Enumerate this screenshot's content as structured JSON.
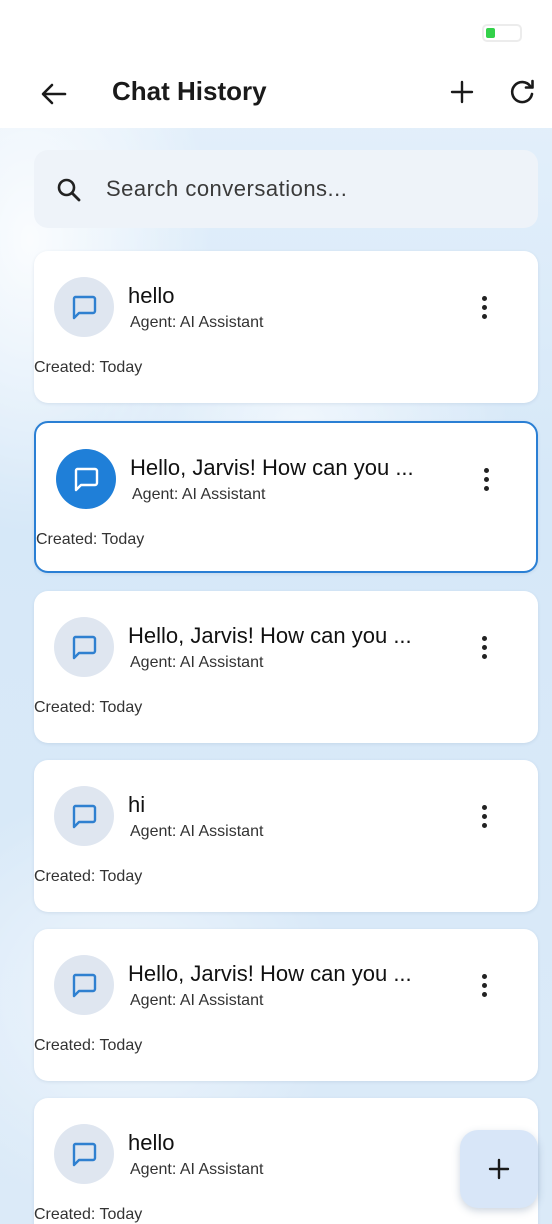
{
  "app_bar": {
    "title": "Chat History",
    "back_icon": "arrow-left-icon",
    "new_icon": "plus-icon",
    "refresh_icon": "refresh-icon"
  },
  "search": {
    "placeholder": "Search conversations...",
    "icon": "search-icon"
  },
  "conversations": [
    {
      "title": "hello",
      "agent": "Agent: AI Assistant",
      "created": "Created: Today",
      "selected": false
    },
    {
      "title": "Hello, Jarvis! How can you ...",
      "agent": "Agent: AI Assistant",
      "created": "Created: Today",
      "selected": true
    },
    {
      "title": "Hello, Jarvis! How can you ...",
      "agent": "Agent: AI Assistant",
      "created": "Created: Today",
      "selected": false
    },
    {
      "title": "hi",
      "agent": "Agent: AI Assistant",
      "created": "Created: Today",
      "selected": false
    },
    {
      "title": "Hello, Jarvis! How can you ...",
      "agent": "Agent: AI Assistant",
      "created": "Created: Today",
      "selected": false
    },
    {
      "title": "hello",
      "agent": "Agent: AI Assistant",
      "created": "Created: Today",
      "selected": false
    }
  ],
  "fab": {
    "icon": "plus-icon"
  },
  "colors": {
    "accent": "#1f7fd8",
    "selected_border": "#2a7fd4",
    "background": "#dcebf8",
    "card": "#ffffff",
    "battery": "#33d14a"
  }
}
